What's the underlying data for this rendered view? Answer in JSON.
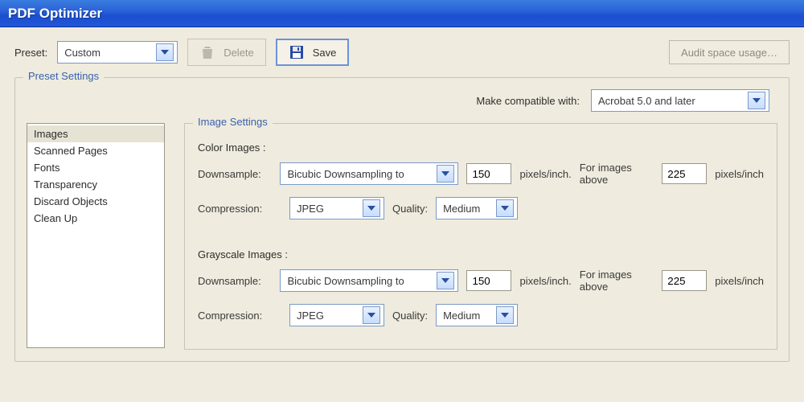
{
  "window": {
    "title": "PDF Optimizer"
  },
  "toolbar": {
    "preset_label": "Preset:",
    "preset_value": "Custom",
    "delete_label": "Delete",
    "save_label": "Save",
    "audit_label": "Audit space usage…"
  },
  "preset_fieldset": {
    "legend": "Preset Settings"
  },
  "compat": {
    "label": "Make compatible with:",
    "value": "Acrobat 5.0 and later"
  },
  "categories": [
    "Images",
    "Scanned Pages",
    "Fonts",
    "Transparency",
    "Discard Objects",
    "Clean Up"
  ],
  "image_settings": {
    "legend": "Image Settings",
    "color_heading": "Color Images :",
    "grayscale_heading": "Grayscale Images :",
    "downsample_label": "Downsample:",
    "downsample_method": "Bicubic Downsampling to",
    "downsample_ppi": "150",
    "ppi_unit": "pixels/inch.",
    "above_label": "For images above",
    "above_ppi": "225",
    "ppi_unit2": "pixels/inch",
    "compression_label": "Compression:",
    "compression_value": "JPEG",
    "quality_label": "Quality:",
    "quality_value": "Medium"
  }
}
